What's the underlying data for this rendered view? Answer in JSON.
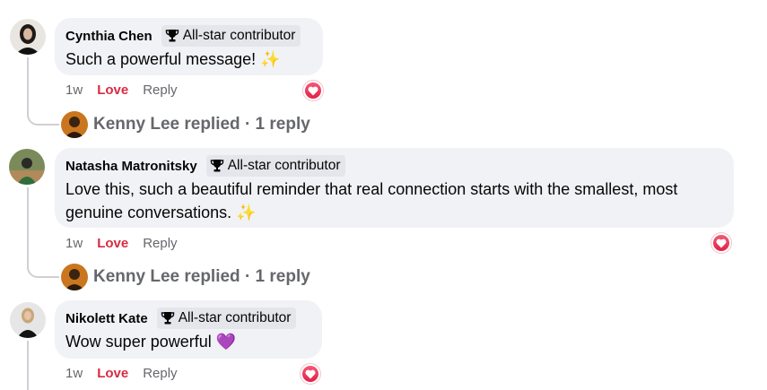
{
  "comments": [
    {
      "author": "Cynthia Chen",
      "badge": "All-star contributor",
      "text": "Such a powerful message! ✨",
      "time": "1w",
      "reaction_label": "Love",
      "reply_label": "Reply",
      "replied_summary": "Kenny Lee replied · 1 reply"
    },
    {
      "author": "Natasha Matronitsky",
      "badge": "All-star contributor",
      "text": "Love this, such a beautiful reminder that real connection starts with the smallest, most genuine conversations. ✨",
      "time": "1w",
      "reaction_label": "Love",
      "reply_label": "Reply",
      "replied_summary": "Kenny Lee replied · 1 reply"
    },
    {
      "author": "Nikolett Kate",
      "badge": "All-star contributor",
      "text": "Wow super powerful 💜",
      "time": "1w",
      "reaction_label": "Love",
      "reply_label": "Reply"
    }
  ],
  "icons": {
    "badge": "trophy-icon",
    "reaction": "heart-reaction-icon"
  },
  "colors": {
    "love_red": "#d92b42",
    "bubble_bg": "#f0f2f5",
    "muted_text": "#65676b"
  }
}
